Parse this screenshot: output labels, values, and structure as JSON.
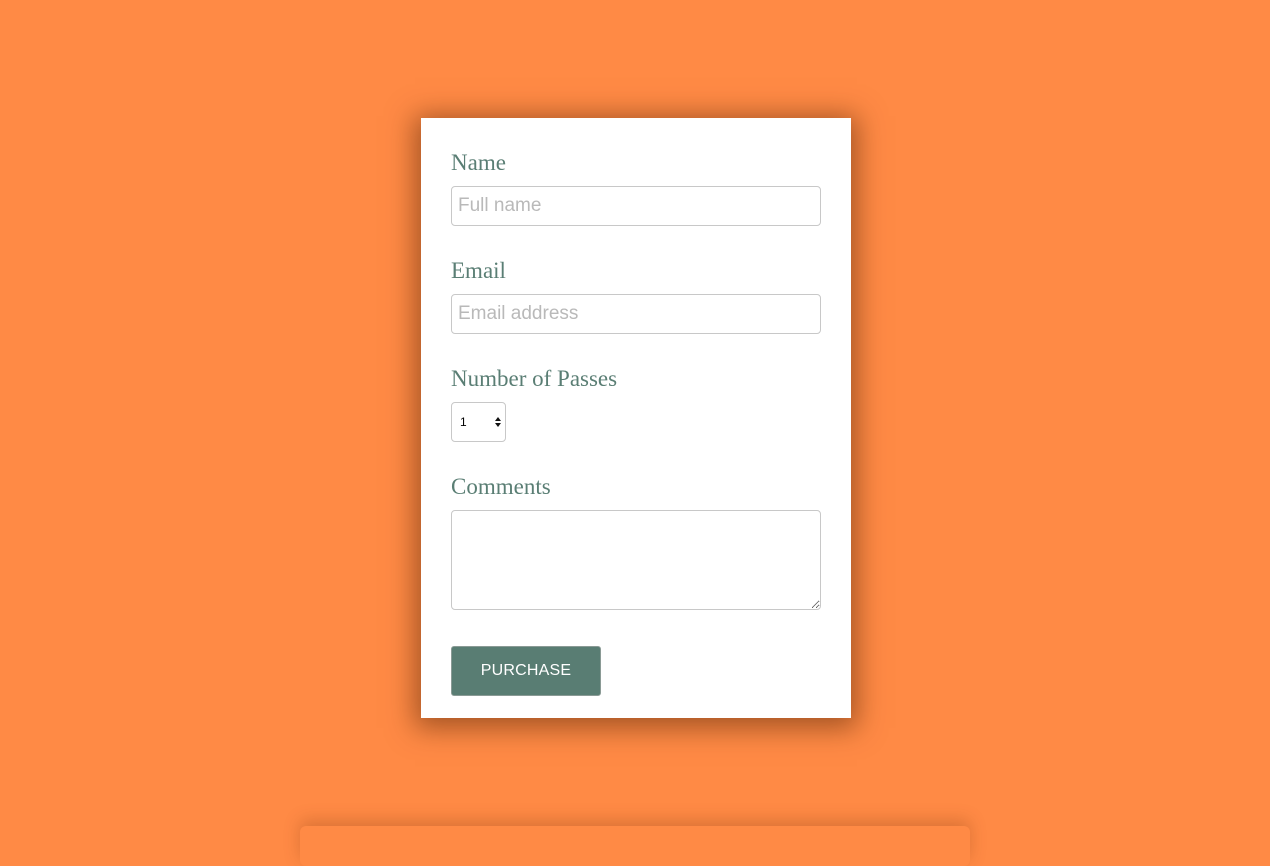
{
  "form": {
    "name": {
      "label": "Name",
      "value": "",
      "placeholder": "Full name"
    },
    "email": {
      "label": "Email",
      "value": "",
      "placeholder": "Email address"
    },
    "passes": {
      "label": "Number of Passes",
      "selected": "1"
    },
    "comments": {
      "label": "Comments",
      "value": ""
    },
    "submit_label": "PURCHASE"
  },
  "colors": {
    "background": "#ff8a45",
    "card": "#ffffff",
    "label": "#5a7e74",
    "button": "#597d73",
    "button_text": "#ffffff"
  }
}
